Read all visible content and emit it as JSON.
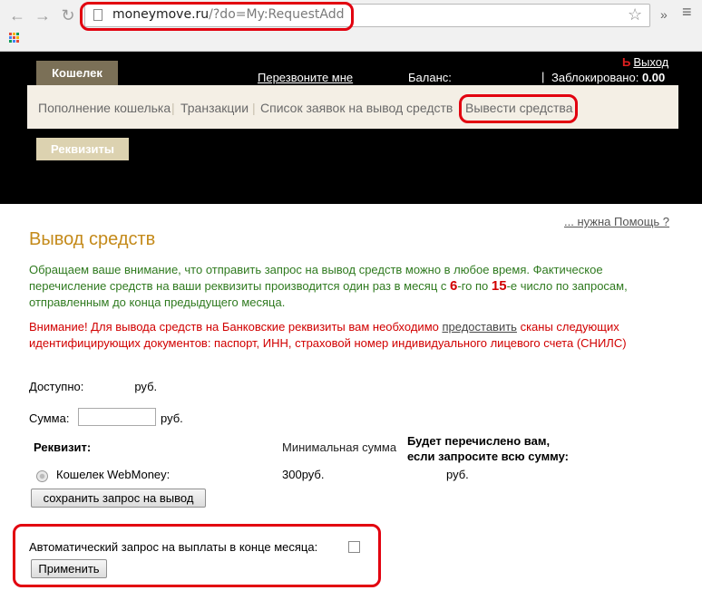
{
  "browser": {
    "url_domain": "moneymove.ru",
    "url_path": "/?do=My:RequestAdd"
  },
  "header": {
    "wallet_tab": "Кошелек",
    "callback": "Перезвоните мне",
    "balance_label": "Баланс:",
    "separator": "|",
    "blocked_label": "Заблокировано:",
    "blocked_value": "0.00",
    "logout": "Выход"
  },
  "submenu": {
    "items": [
      "Пополнение кошелька",
      "Транзакции",
      "Список заявок на вывод средств",
      "Вывести средства"
    ]
  },
  "requisites_button": "Реквизиты",
  "main": {
    "help_link": "... нужна Помощь ?",
    "title": "Вывод средств",
    "notice_part1": "Обращаем ваше внимание, что отправить запрос на вывод средств можно в любое время. Фактическое перечисление средств на ваши реквизиты производится один раз в месяц с ",
    "notice_day_from": "6",
    "notice_part2": "-го по ",
    "notice_day_to": "15",
    "notice_part3": "-е число по запросам, отправленным до конца предыдущего месяца.",
    "warning_part1": "Внимание! Для вывода средств на Банковские реквизиты вам необходимо ",
    "warning_link": "предоставить",
    "warning_part2": " сканы следующих идентифицирующих документов: паспорт, ИНН, страховой номер индивидуального лицевого счета (СНИЛС)",
    "available_label": "Доступно:",
    "available_unit": "руб.",
    "sum_label": "Сумма:",
    "sum_value": "",
    "sum_unit": "руб.",
    "table": {
      "col_requisite": "Реквизит:",
      "col_min": "Минимальная сумма",
      "col_total_line1": "Будет перечислено вам,",
      "col_total_line2": "если запросите всю сумму:",
      "row_name": "Кошелек WebMoney:",
      "row_min": "300руб.",
      "row_total": "руб."
    },
    "save_button": "сохранить запрос на вывод",
    "auto_label": "Автоматический запрос на выплаты в конце месяца:",
    "apply_button": "Применить"
  },
  "colors": {
    "highlight": "#e2000f",
    "title": "#c48a1a",
    "notice": "#2f7a1f",
    "warning": "#d10000"
  }
}
